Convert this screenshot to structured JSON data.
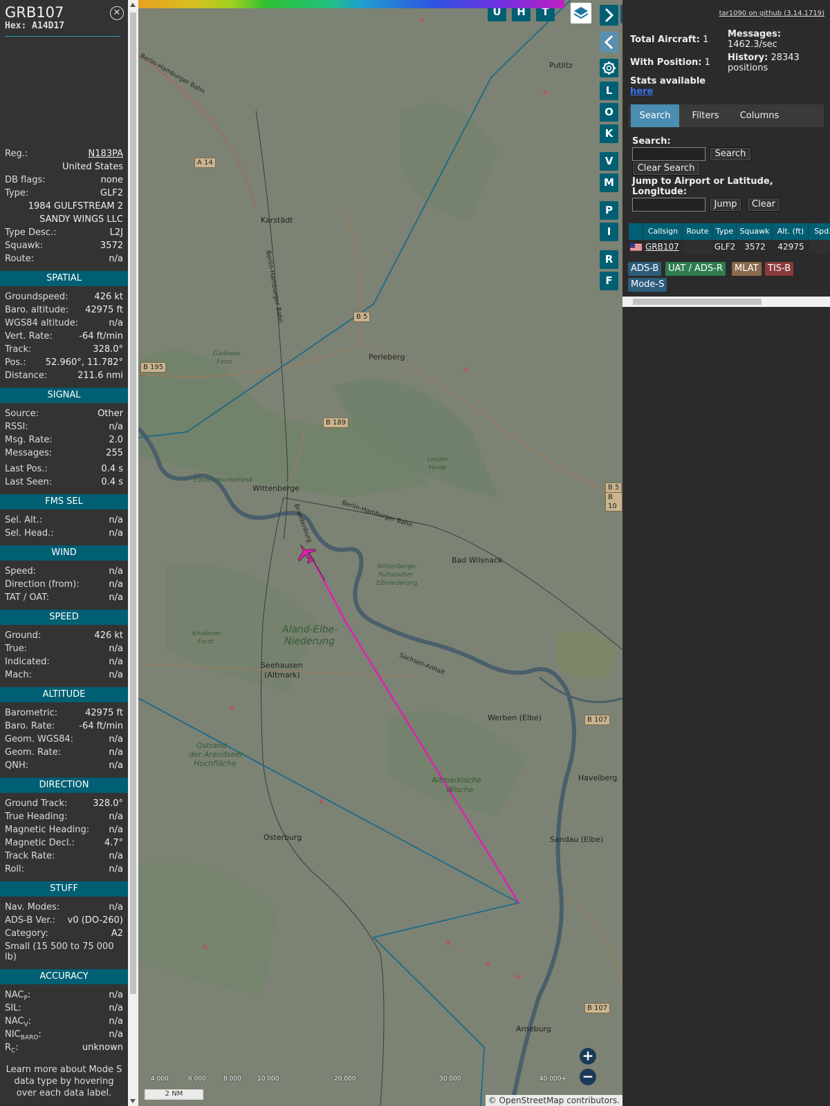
{
  "info": {
    "callsign": "GRB107",
    "hex": "Hex: A14D17",
    "reg_label": "Reg.:",
    "reg": "N183PA",
    "country": "United States",
    "dbflags_label": "DB flags:",
    "dbflags": "none",
    "type_label": "Type:",
    "type": "GLF2",
    "type_full": "1984 GULFSTREAM 2",
    "owner": "SANDY WINGS LLC",
    "typedesc_label": "Type Desc.:",
    "typedesc": "L2J",
    "squawk_label": "Squawk:",
    "squawk": "3572",
    "route_label": "Route:",
    "route": "n/a",
    "sections": {
      "spatial": "SPATIAL",
      "signal": "SIGNAL",
      "fms": "FMS SEL",
      "wind": "WIND",
      "speed": "SPEED",
      "altitude": "ALTITUDE",
      "direction": "DIRECTION",
      "stuff": "STUFF",
      "accuracy": "ACCURACY"
    },
    "spatial": [
      [
        "Groundspeed:",
        "426 kt"
      ],
      [
        "Baro. altitude:",
        "42975 ft"
      ],
      [
        "WGS84 altitude:",
        "n/a"
      ],
      [
        "Vert. Rate:",
        "-64 ft/min"
      ],
      [
        "Track:",
        "328.0°"
      ],
      [
        "Pos.:",
        "52.960°, 11.782°"
      ],
      [
        "Distance:",
        "211.6 nmi"
      ]
    ],
    "signal": [
      [
        "Source:",
        "Other"
      ],
      [
        "RSSI:",
        "n/a"
      ],
      [
        "Msg. Rate:",
        "2.0"
      ],
      [
        "Messages:",
        "255"
      ],
      [
        "Last Pos.:",
        "0.4 s"
      ],
      [
        "Last Seen:",
        "0.4 s"
      ]
    ],
    "fms": [
      [
        "Sel. Alt.:",
        "n/a"
      ],
      [
        "Sel. Head.:",
        "n/a"
      ]
    ],
    "wind": [
      [
        "Speed:",
        "n/a"
      ],
      [
        "Direction (from):",
        "n/a"
      ],
      [
        "TAT / OAT:",
        "n/a"
      ]
    ],
    "speed": [
      [
        "Ground:",
        "426 kt"
      ],
      [
        "True:",
        "n/a"
      ],
      [
        "Indicated:",
        "n/a"
      ],
      [
        "Mach:",
        "n/a"
      ]
    ],
    "altitude": [
      [
        "Barometric:",
        "42975 ft"
      ],
      [
        "Baro. Rate:",
        "-64 ft/min"
      ],
      [
        "Geom. WGS84:",
        "n/a"
      ],
      [
        "Geom. Rate:",
        "n/a"
      ],
      [
        "QNH:",
        "n/a"
      ]
    ],
    "direction": [
      [
        "Ground Track:",
        "328.0°"
      ],
      [
        "True Heading:",
        "n/a"
      ],
      [
        "Magnetic Heading:",
        "n/a"
      ],
      [
        "Magnetic Decl.:",
        "4.7°"
      ],
      [
        "Track Rate:",
        "n/a"
      ],
      [
        "Roll:",
        "n/a"
      ]
    ],
    "stuff": [
      [
        "Nav. Modes:",
        "n/a"
      ],
      [
        "ADS-B Ver.:",
        "v0 (DO-260)"
      ],
      [
        "Category:",
        "A2"
      ]
    ],
    "category_desc": "Small (15 500 to 75 000 lb)",
    "accuracy": {
      "nacp_label": "NAC",
      "nacp_sub": "P",
      "nacp": "n/a",
      "sil_label": "SIL:",
      "sil": "n/a",
      "nacv_label": "NAC",
      "nacv_sub": "V",
      "nacv": "n/a",
      "nicbaro_label": "NIC",
      "nicbaro_sub": "BARO",
      "nicbaro": "n/a",
      "rc_label": "R",
      "rc_sub": "C",
      "rc": "unknown"
    },
    "note": "Learn more about Mode S data type by hovering over each data label."
  },
  "map": {
    "buttons_top": [
      "U",
      "H",
      "T"
    ],
    "buttons_side": [
      "L",
      "O",
      "K",
      "V",
      "M",
      "P",
      "I",
      "R",
      "F"
    ],
    "labels": {
      "putlitz": "Putlitz",
      "karstadt": "Karstädt",
      "perleberg": "Perleberg",
      "wittenberge": "Wittenberge",
      "bad_wilsnack": "Bad Wilsnack",
      "seehausen": "Seehausen",
      "seehausen2": "(Altmark)",
      "werben": "Werben (Elbe)",
      "havelberg": "Havelberg",
      "osterburg": "Osterburg",
      "sandau": "Sandau (Elbe)",
      "arneburg": "Arneburg",
      "aland1": "Aland-Elbe-",
      "aland2": "Niederung",
      "altmark1": "Altmarkische",
      "altmark2": "Wische",
      "ostrand1": "Ostrand",
      "ostrand2": "der Arendseer",
      "ostrand3": "Hochfläche",
      "gadow1": "Gadower",
      "gadow2": "Forst",
      "lenzer1": "Lenzer",
      "lenzer2": "Heide",
      "elbdeich": "Elbdeichhinterland",
      "wbr1": "Wittenberge-",
      "wbr2": "Ruhstadter",
      "wbr3": "Elbniederung",
      "krud1": "Krudener",
      "krud2": "Forst",
      "bhb1": "Berlin-Hamburger Bahn",
      "bhb2": "Berlin-Hamburger Bahn",
      "bhb3": "Berlin-Hamburger Bahn",
      "sachsen": "Sachsen-Anhalt",
      "brandenburg": "Brandenburg"
    },
    "roads": {
      "a14": "A 14",
      "b5": "B 5",
      "b195": "B 195",
      "b189": "B 189",
      "b107a": "B 107",
      "b107b": "B 107",
      "b5r": "B 5",
      "b10": "B 10"
    },
    "altitude_scale": [
      "4 000",
      "6 000",
      "8 000",
      "10 000",
      "20 000",
      "30 000",
      "40 000+"
    ],
    "scale_bar": "2 NM",
    "attribution": "© OpenStreetMap contributors.",
    "zoom_in": "+",
    "zoom_out": "−"
  },
  "right": {
    "github": "tar1090 on github (3.14.1719)",
    "total_label": "Total Aircraft:",
    "total": "1",
    "withpos_label": "With Position:",
    "withpos": "1",
    "messages_label": "Messages:",
    "messages": "1462.3/sec",
    "history_label": "History:",
    "history": "28343",
    "history_unit": "positions",
    "stats_text": "Stats available",
    "stats_link": "here",
    "tabs": [
      "Search",
      "Filters",
      "Columns"
    ],
    "search_label": "Search:",
    "search_button": "Search",
    "clear_search": "Clear Search",
    "jump_label": "Jump to Airport or Latitude, Longitude:",
    "jump_button": "Jump",
    "clear_button": "Clear",
    "columns": [
      "Callsign",
      "Route",
      "Type",
      "Squawk",
      "Alt. (ft)",
      "Spd."
    ],
    "row": {
      "callsign": "GRB107",
      "route": "",
      "type": "GLF2",
      "squawk": "3572",
      "alt": "42975"
    },
    "badges": [
      "ADS-B",
      "UAT / ADS-R",
      "MLAT",
      "TIS-B",
      "Mode-S"
    ]
  },
  "colors": {
    "accent": "#005f73",
    "track": "#e020b0",
    "route_line": "#1a6a8a",
    "adsb": "#2c5d7c",
    "uat": "#2e7d4e",
    "mlat": "#8a6a4a",
    "tisb": "#8a3a3a",
    "modes": "#2c5d7c"
  }
}
